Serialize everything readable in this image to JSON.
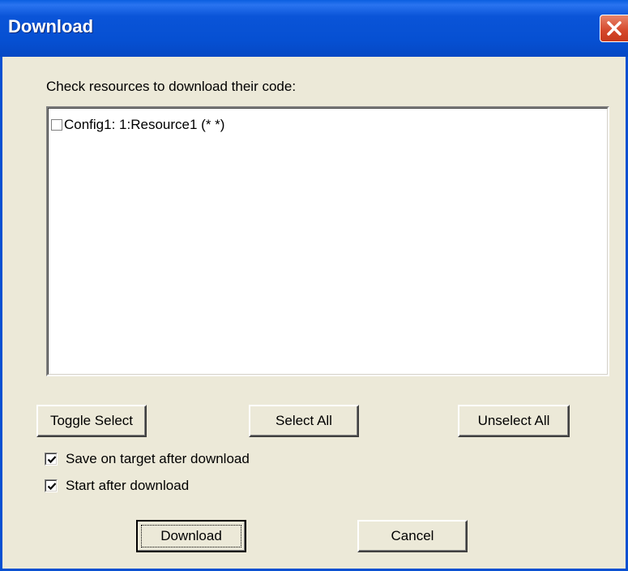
{
  "window": {
    "title": "Download"
  },
  "prompt": "Check resources to download their code:",
  "resources": [
    {
      "label": "Config1:  1:Resource1 (*  *)",
      "checked": false
    }
  ],
  "buttons": {
    "toggle_select": "Toggle Select",
    "select_all": "Select All",
    "unselect_all": "Unselect All",
    "download": "Download",
    "cancel": "Cancel"
  },
  "options": {
    "save_on_target": {
      "label": "Save on target after download",
      "checked": true
    },
    "start_after": {
      "label": "Start after download",
      "checked": true
    }
  },
  "icons": {
    "close": "close-icon",
    "check": "check-icon"
  },
  "colors": {
    "titlebar": "#0650d2",
    "close": "#d4472a",
    "face": "#ece9d8"
  }
}
